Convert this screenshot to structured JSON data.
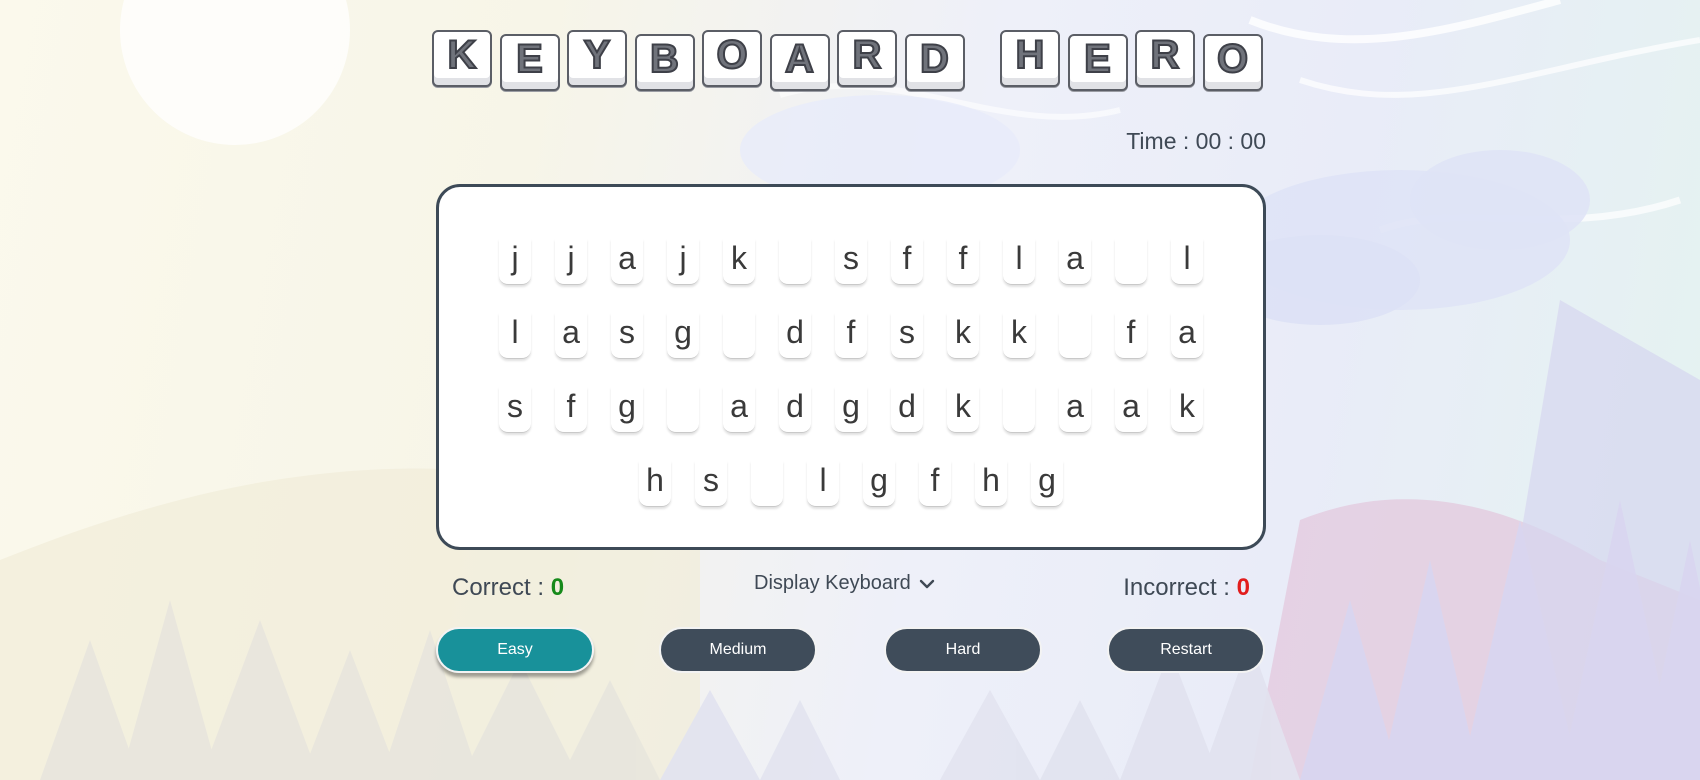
{
  "title": {
    "letters": [
      "K",
      "E",
      "Y",
      "B",
      "O",
      "A",
      "R",
      "D",
      "H",
      "E",
      "R",
      "O"
    ]
  },
  "timer": {
    "label": "Time : 00 : 00"
  },
  "board": {
    "rows": [
      [
        "j",
        "j",
        "a",
        "j",
        "k",
        "",
        "s",
        "f",
        "f",
        "l",
        "a",
        "",
        "l"
      ],
      [
        "l",
        "a",
        "s",
        "g",
        "",
        "d",
        "f",
        "s",
        "k",
        "k",
        "",
        "f",
        "a"
      ],
      [
        "s",
        "f",
        "g",
        "",
        "a",
        "d",
        "g",
        "d",
        "k",
        "",
        "a",
        "a",
        "k"
      ],
      [
        "h",
        "s",
        "",
        "l",
        "g",
        "f",
        "h",
        "g"
      ]
    ]
  },
  "stats": {
    "correct_label": "Correct : ",
    "correct_value": "0",
    "incorrect_label": "Incorrect : ",
    "incorrect_value": "0"
  },
  "display_keyboard": {
    "label": "Display Keyboard"
  },
  "buttons": {
    "easy": "Easy",
    "medium": "Medium",
    "hard": "Hard",
    "restart": "Restart"
  },
  "colors": {
    "correct": "#168a1a",
    "incorrect": "#e21d1d",
    "active_button": "#18919a",
    "button": "#3f4c5a",
    "board_border": "#3d4a57"
  }
}
